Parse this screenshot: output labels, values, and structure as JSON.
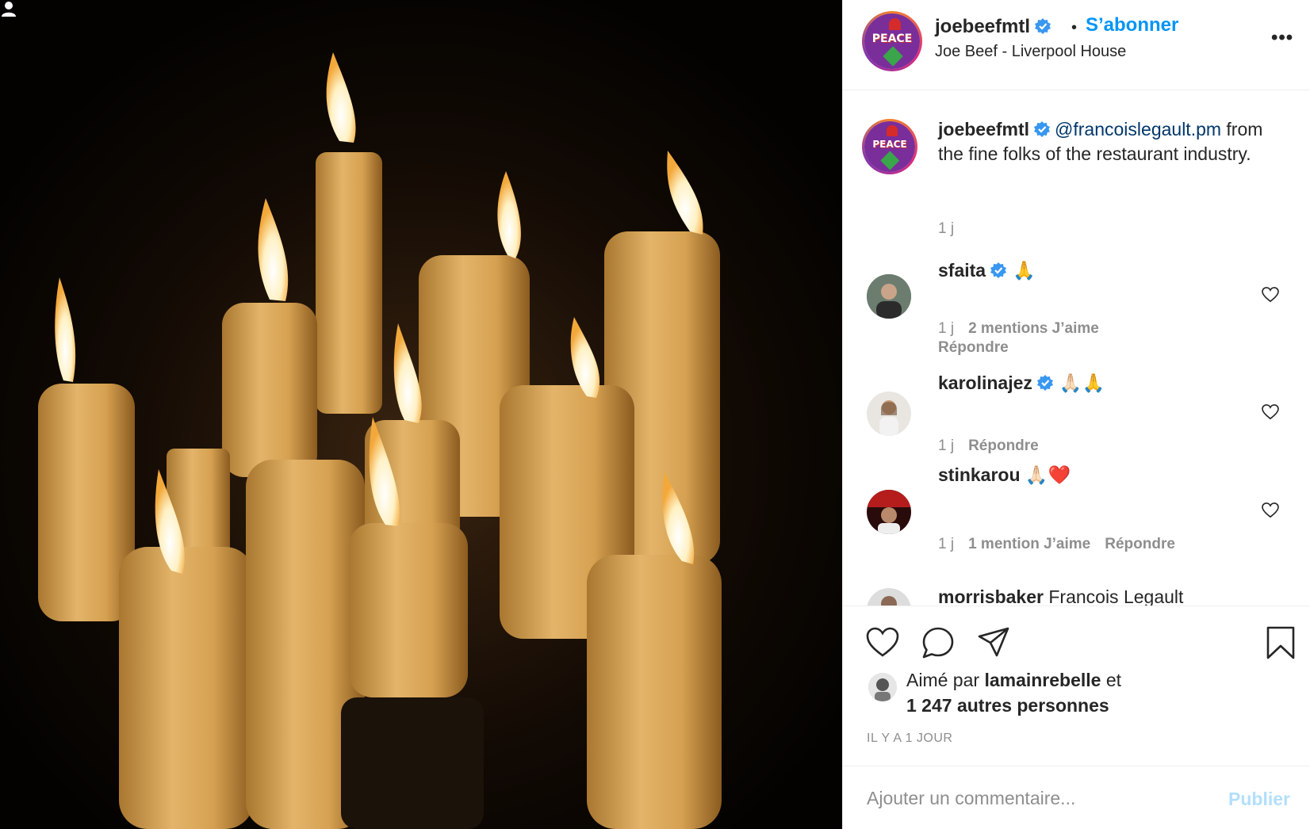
{
  "post": {
    "image_alt": "",
    "username": "joebeefmtl",
    "follow_label": "S’abonner",
    "location": "Joe Beef - Liverpool House",
    "more_label": "•••"
  },
  "caption": {
    "username": "joebeefmtl",
    "mention": "@francoislegault.pm",
    "emoji": "",
    "text": "from the fine folks of the restaurant industry.",
    "time": "1 j"
  },
  "comments": [
    {
      "username": "sfaita",
      "verified": true,
      "text": "🙏",
      "time": "1 j",
      "likes": "2 mentions J’aime",
      "reply": "Répondre"
    },
    {
      "username": "karolinajez",
      "verified": true,
      "text": "🙏🏻🙏",
      "time": "1 j",
      "likes": "",
      "reply": "Répondre"
    },
    {
      "username": "stinkarou",
      "verified": false,
      "text": "🙏🏻❤️",
      "time": "1 j",
      "likes": "1 mention J’aime",
      "reply": "Répondre"
    },
    {
      "username": "morrisbaker",
      "verified": false,
      "text": "Francois Legault",
      "time": "",
      "likes": "",
      "reply": ""
    }
  ],
  "likes": {
    "prefix": "Aimé par",
    "user": "lamainrebelle",
    "joiner": "et",
    "others": "1 247 autres personnes"
  },
  "age": "IL Y A 1 JOUR",
  "add_comment": {
    "placeholder": "Ajouter un commentaire...",
    "publish_label": "Publier"
  },
  "colors": {
    "accent": "#0095f6",
    "mention": "#00376b",
    "muted": "#8e8e8e",
    "publish_disabled": "#b2dffc"
  }
}
